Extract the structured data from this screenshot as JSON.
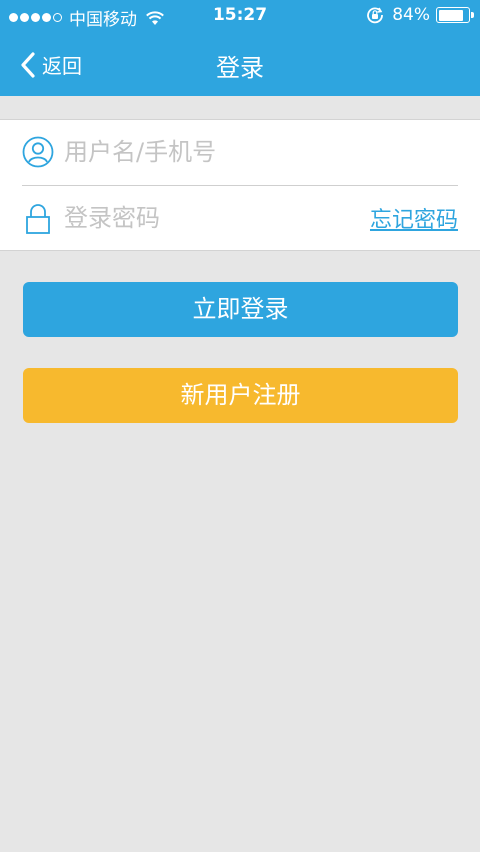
{
  "status_bar": {
    "carrier": "中国移动",
    "time": "15:27",
    "battery_percent": "84%",
    "battery_level": 0.84,
    "signal_dots_filled": 4,
    "icons": [
      "signal-dots",
      "wifi-icon",
      "rotation-lock-icon",
      "battery-icon"
    ]
  },
  "nav": {
    "back_label": "返回",
    "title": "登录"
  },
  "form": {
    "username": {
      "value": "",
      "placeholder": "用户名/手机号",
      "icon": "user-icon"
    },
    "password": {
      "value": "",
      "placeholder": "登录密码",
      "icon": "lock-icon"
    },
    "forgot_label": "忘记密码"
  },
  "buttons": {
    "login_label": "立即登录",
    "register_label": "新用户注册"
  },
  "colors": {
    "primary": "#2ea5df",
    "register": "#f7b92e",
    "background": "#e6e6e6",
    "placeholder": "#c4c4c4"
  }
}
